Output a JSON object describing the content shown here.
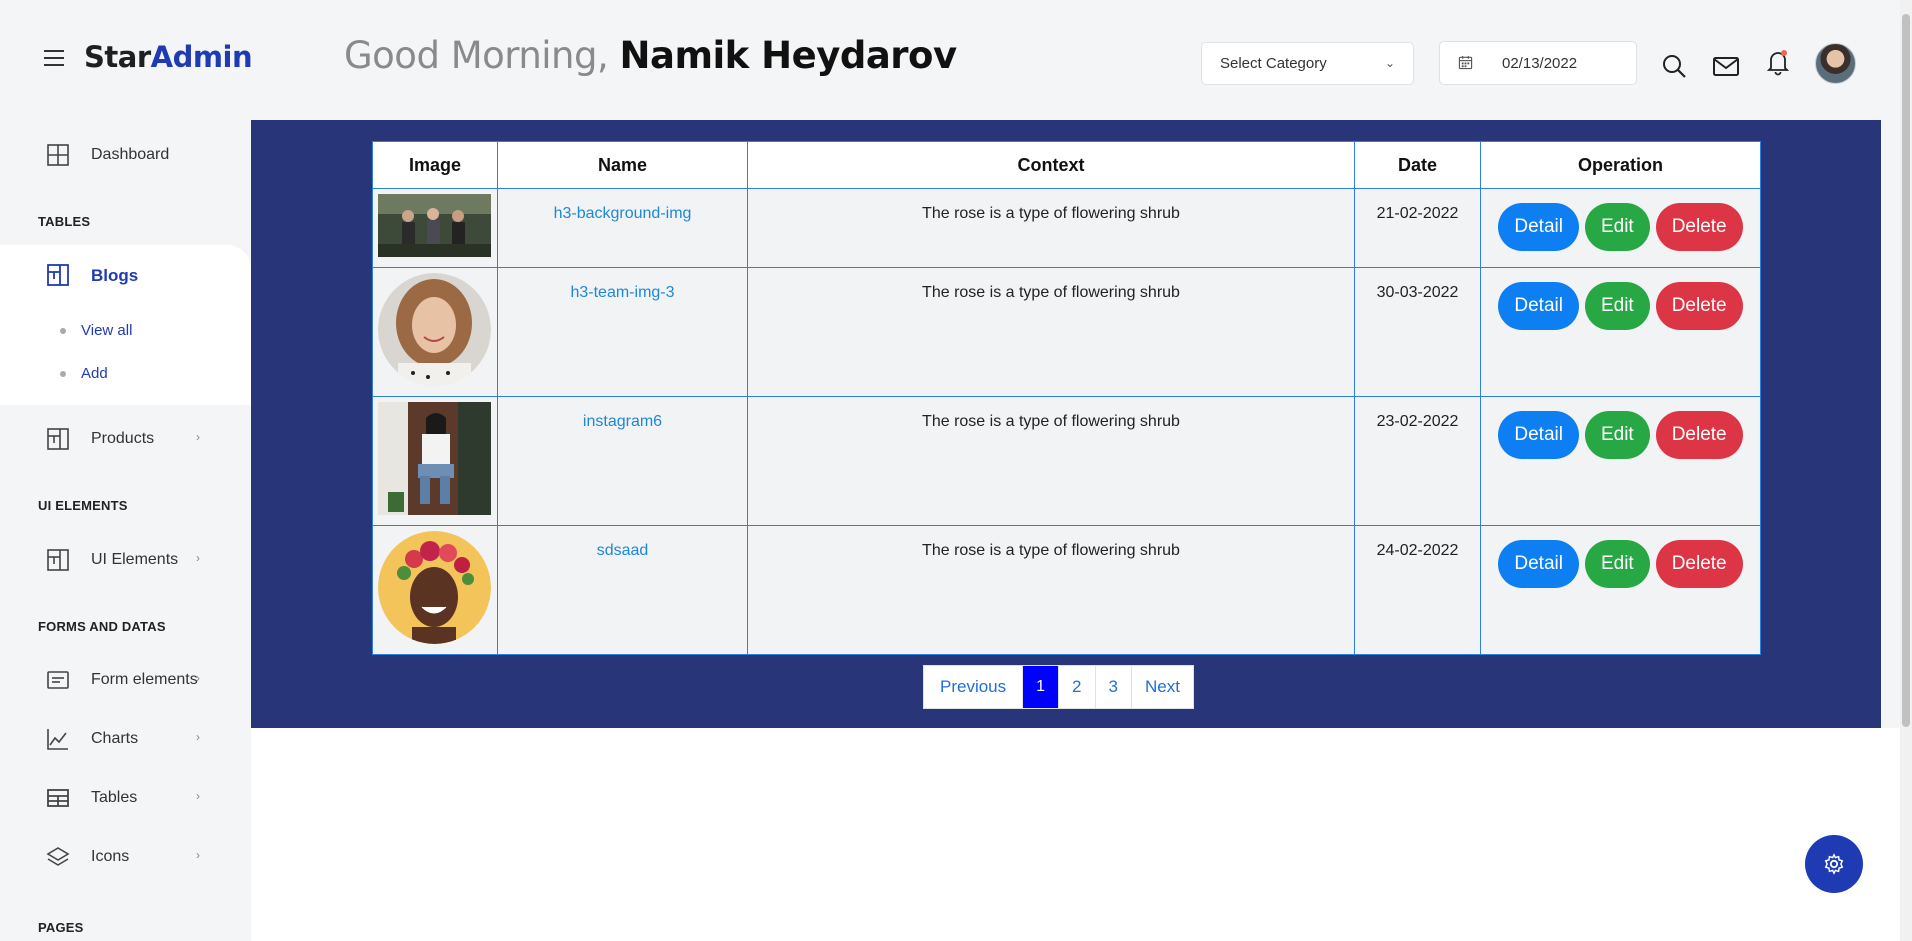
{
  "brand": {
    "part1": "Star",
    "part2": "Admin",
    "accent": "#1f3bb3"
  },
  "header": {
    "greeting_prefix": "Good Morning, ",
    "user_name": "Namik Heydarov",
    "category_select": "Select Category",
    "date_value": "02/13/2022",
    "icons": [
      "search-icon",
      "mail-icon",
      "bell-icon"
    ]
  },
  "sidebar": {
    "dashboard": "Dashboard",
    "section_tables": "TABLES",
    "blogs": "Blogs",
    "blogs_sub": [
      "View all",
      "Add"
    ],
    "products": "Products",
    "section_ui": "UI ELEMENTS",
    "ui_elements": "UI Elements",
    "section_forms": "FORMS AND DATAS",
    "form_elements": "Form elements",
    "charts": "Charts",
    "tables": "Tables",
    "icons": "Icons",
    "section_pages": "PAGES"
  },
  "table": {
    "headers": [
      "Image",
      "Name",
      "Context",
      "Date",
      "Operation"
    ],
    "rows": [
      {
        "image": "group-photo",
        "name": "h3-background-img",
        "context": "The rose is a type of flowering shrub",
        "date": "21-02-2022"
      },
      {
        "image": "woman-portrait",
        "name": "h3-team-img-3",
        "context": "The rose is a type of flowering shrub",
        "date": "30-03-2022"
      },
      {
        "image": "woman-sitting",
        "name": "instagram6",
        "context": "The rose is a type of flowering shrub",
        "date": "23-02-2022"
      },
      {
        "image": "flower-crown",
        "name": "sdsaad",
        "context": "The rose is a type of flowering shrub",
        "date": "24-02-2022"
      }
    ],
    "buttons": {
      "detail": "Detail",
      "edit": "Edit",
      "delete": "Delete"
    }
  },
  "pagination": {
    "previous": "Previous",
    "pages": [
      "1",
      "2",
      "3"
    ],
    "next": "Next",
    "active": "1"
  },
  "colors": {
    "panel": "#283578",
    "detail": "#0d7ff2",
    "edit": "#28a745",
    "delete": "#dc3545",
    "active_page": "#0000ff"
  }
}
